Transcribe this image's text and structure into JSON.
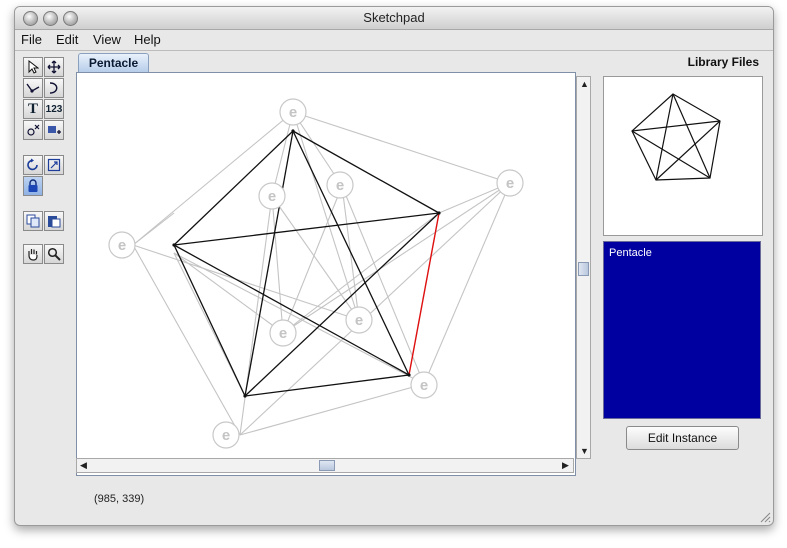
{
  "window": {
    "title": "Sketchpad"
  },
  "menu": {
    "items": [
      "File",
      "Edit",
      "View",
      "Help"
    ]
  },
  "tabs": [
    {
      "label": "Pentacle"
    }
  ],
  "toolbar": {
    "tools": [
      {
        "icon": "select-arrow-icon"
      },
      {
        "icon": "move-cross-icon"
      },
      {
        "icon": "polyline-icon"
      },
      {
        "icon": "curve-icon"
      },
      {
        "icon": "text-tool-icon",
        "glyph": "T"
      },
      {
        "icon": "number-tool-icon",
        "glyph": "123"
      },
      {
        "icon": "node-tool-icon"
      },
      {
        "icon": "instance-tool-icon"
      },
      {
        "icon": "rotate-icon"
      },
      {
        "icon": "scale-icon"
      },
      {
        "icon": "lock-icon"
      },
      {
        "icon": "copy-icon"
      },
      {
        "icon": "paste-icon"
      },
      {
        "icon": "hand-icon"
      },
      {
        "icon": "magnifier-icon"
      }
    ]
  },
  "canvas": {
    "node_label": "e"
  },
  "status": {
    "coordinates": "(985, 339)"
  },
  "library": {
    "title": "Library Files",
    "items": [
      "Pentacle"
    ],
    "edit_button": "Edit Instance"
  }
}
